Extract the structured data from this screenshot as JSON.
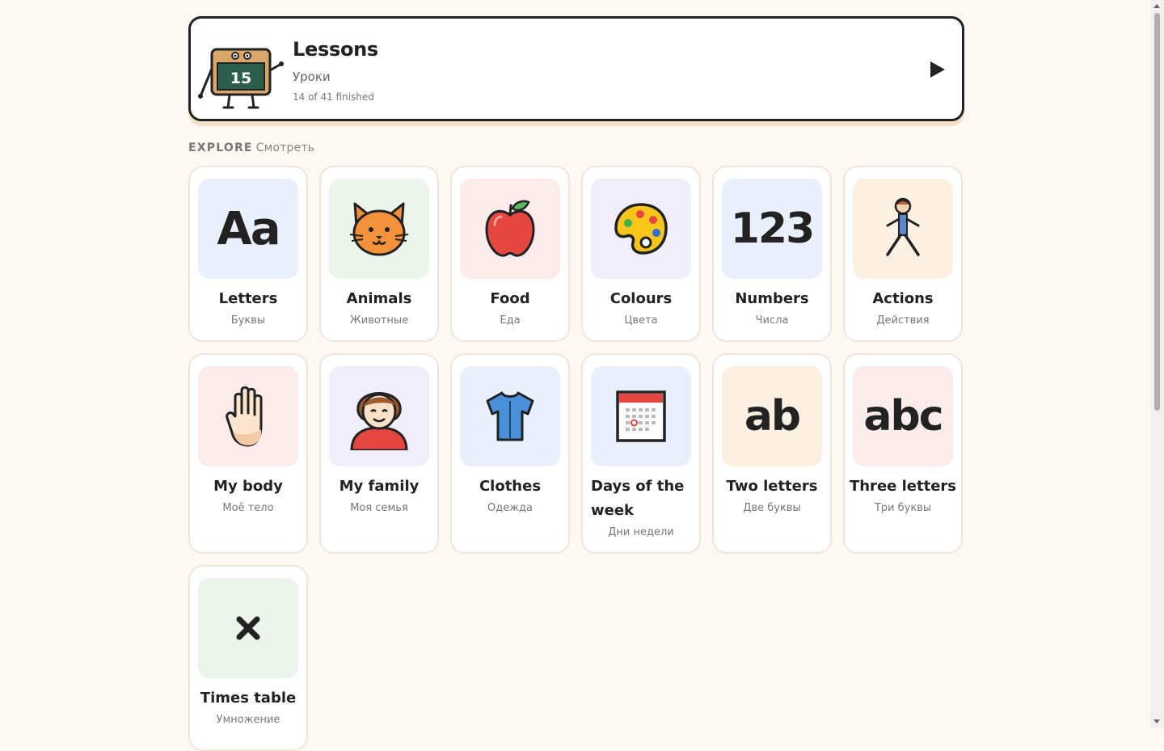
{
  "lessons": {
    "title": "Lessons",
    "subtitle": "Уроки",
    "progress": "14 of 41 finished",
    "icon_number": "15"
  },
  "explore": {
    "label": "EXPLORE",
    "sublabel": "Смотреть"
  },
  "categories": [
    {
      "title": "Letters",
      "subtitle": "Буквы",
      "icon": "Aa",
      "tile_color": "#e9f0fb"
    },
    {
      "title": "Animals",
      "subtitle": "Животные",
      "icon": "cat-icon",
      "tile_color": "#ecf5ec"
    },
    {
      "title": "Food",
      "subtitle": "Еда",
      "icon": "apple-icon",
      "tile_color": "#fcebeb"
    },
    {
      "title": "Colours",
      "subtitle": "Цвета",
      "icon": "palette-icon",
      "tile_color": "#f1eefb"
    },
    {
      "title": "Numbers",
      "subtitle": "Числа",
      "icon": "123",
      "tile_color": "#e9f0fb"
    },
    {
      "title": "Actions",
      "subtitle": "Действия",
      "icon": "stick-figure-icon",
      "tile_color": "#fbf0e2"
    },
    {
      "title": "My body",
      "subtitle": "Моё тело",
      "icon": "hand-icon",
      "tile_color": "#fcebeb"
    },
    {
      "title": "My family",
      "subtitle": "Моя семья",
      "icon": "person-icon",
      "tile_color": "#f1eefb"
    },
    {
      "title": "Clothes",
      "subtitle": "Одежда",
      "icon": "shirt-icon",
      "tile_color": "#e9f0fb"
    },
    {
      "title": "Days of the week",
      "subtitle": "Дни недели",
      "icon": "calendar-icon",
      "tile_color": "#e9f0fb"
    },
    {
      "title": "Two letters",
      "subtitle": "Две буквы",
      "icon": "ab",
      "tile_color": "#fbf0e2"
    },
    {
      "title": "Three letters",
      "subtitle": "Три буквы",
      "icon": "abc",
      "tile_color": "#fcebeb"
    },
    {
      "title": "Times table",
      "subtitle": "Умножение",
      "icon": "multiply-icon",
      "tile_color": "#ecf5ec"
    }
  ]
}
